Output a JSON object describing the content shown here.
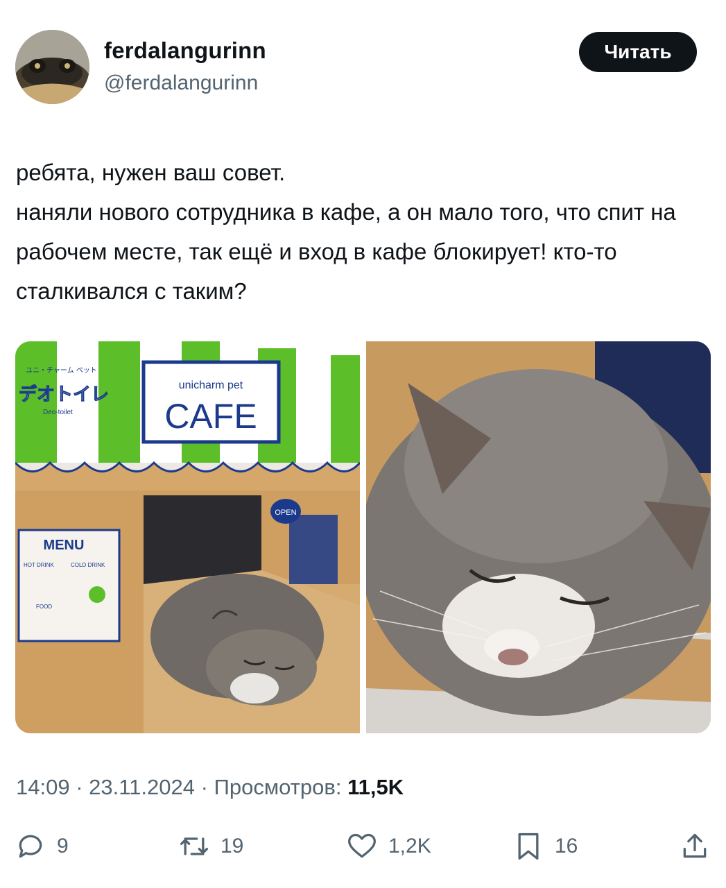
{
  "header": {
    "display_name": "ferdalangurinn",
    "handle": "@ferdalangurinn",
    "follow_label": "Читать"
  },
  "tweet": {
    "text": "ребята, нужен ваш совет.\nнаняли нового сотрудника в кафе, а он мало того, что спит на рабочем месте, так ещё и вход в кафе блокирует! кто-то сталкивался с таким?"
  },
  "media": {
    "box_labels": {
      "brand_small": "ユニ・チャーム ペット",
      "brand_jp": "デオトイレ",
      "brand_sub": "Deo-toilet",
      "sign_top": "unicharm pet",
      "sign_main": "CAFE",
      "open": "OPEN",
      "menu_title": "MENU",
      "hot_drink": "HOT DRINK",
      "cold_drink": "COLD DRINK",
      "food": "FOOD"
    }
  },
  "meta": {
    "time": "14:09",
    "sep1": " · ",
    "date": "23.11.2024",
    "sep2": " · ",
    "views_label": "Просмотров: ",
    "views_count": "11,5K"
  },
  "actions": {
    "replies": "9",
    "reposts": "19",
    "likes": "1,2K",
    "bookmarks": "16"
  },
  "icons": [
    "avatar",
    "reply-icon",
    "repost-icon",
    "like-icon",
    "bookmark-icon",
    "share-icon"
  ],
  "colors": {
    "text": "#0f1419",
    "secondary": "#536471",
    "button": "#0f1419",
    "box_green": "#5cbf2a",
    "box_navy": "#1b3a8c"
  }
}
